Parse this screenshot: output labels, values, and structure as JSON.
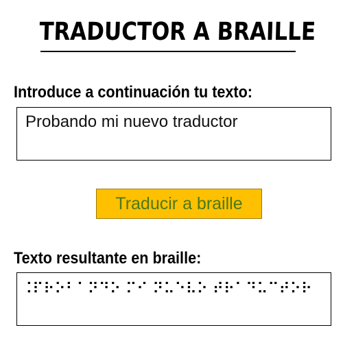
{
  "title": "TRADUCTOR A BRAILLE",
  "input": {
    "label": "Introduce a continuación tu texto:",
    "value": "Probando mi nuevo traductor"
  },
  "button": {
    "label": "Traducir a braille",
    "background_color": "#ffc000",
    "text_color": "#4a7a1a"
  },
  "output": {
    "label": "Texto resultante en braille:",
    "value": "⠨⠏⠗⠕⠃⠁⠝⠙⠕ ⠍⠊ ⠝⠥⠑⠧⠕ ⠞⠗⠁⠙⠥⠉⠞⠕⠗"
  }
}
